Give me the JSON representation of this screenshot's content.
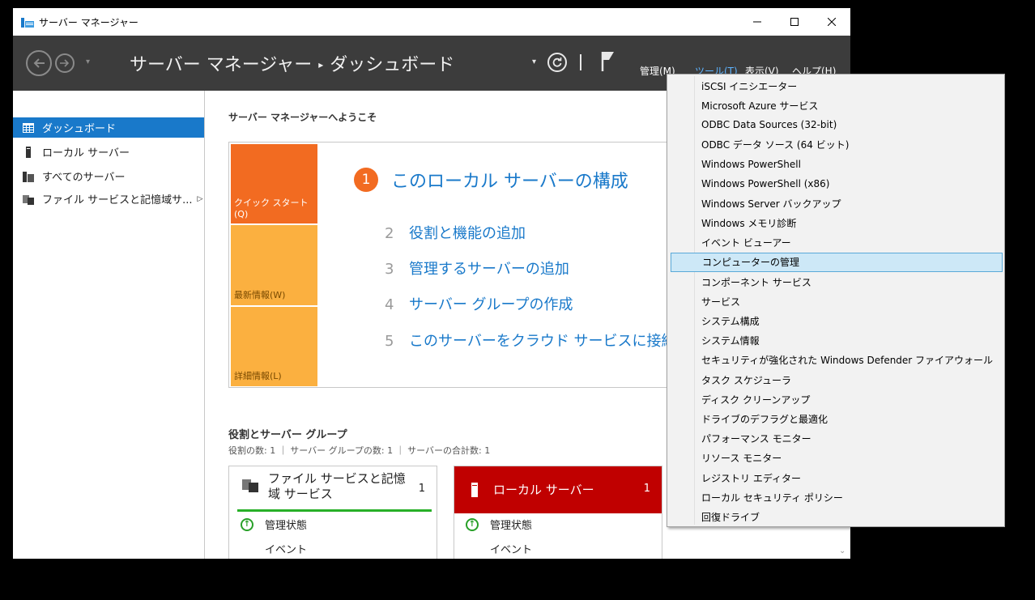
{
  "window": {
    "title": "サーバー マネージャー"
  },
  "header": {
    "breadcrumb_root": "サーバー マネージャー",
    "breadcrumb_sep": "▸",
    "breadcrumb_page": "ダッシュボード",
    "menus": [
      "管理(M)",
      "ツール(T)",
      "表示(V)",
      "ヘルプ(H)"
    ]
  },
  "sidebar": {
    "items": [
      {
        "label": "ダッシュボード",
        "icon": "dashboard-icon"
      },
      {
        "label": "ローカル サーバー",
        "icon": "server-icon"
      },
      {
        "label": "すべてのサーバー",
        "icon": "servers-icon"
      },
      {
        "label": "ファイル サービスと記憶域サ...",
        "icon": "file-services-icon"
      }
    ]
  },
  "main": {
    "welcome": "サーバー マネージャーへようこそ",
    "tiles": [
      "クイック スタート(Q)",
      "最新情報(W)",
      "詳細情報(L)"
    ],
    "step1": {
      "num": "1",
      "text": "このローカル サーバーの構成"
    },
    "steps": [
      {
        "num": "2",
        "text": "役割と機能の追加"
      },
      {
        "num": "3",
        "text": "管理するサーバーの追加"
      },
      {
        "num": "4",
        "text": "サーバー グループの作成"
      },
      {
        "num": "5",
        "text": "このサーバーをクラウド サービスに接続す"
      }
    ],
    "roles_title": "役割とサーバー グループ",
    "roles_sub": "役割の数: 1 ｜ サーバー グループの数: 1 ｜ サーバーの合計数: 1",
    "cards": [
      {
        "title": "ファイル サービスと記憶域 サービス",
        "count": "1",
        "rows": [
          "管理状態",
          "イベント"
        ]
      },
      {
        "title": "ローカル サーバー",
        "count": "1",
        "rows": [
          "管理状態",
          "イベント"
        ]
      }
    ]
  },
  "tools_menu": {
    "items": [
      "iSCSI イニシエーター",
      "Microsoft Azure サービス",
      "ODBC Data Sources (32-bit)",
      "ODBC データ ソース (64 ビット)",
      "Windows PowerShell",
      "Windows PowerShell (x86)",
      "Windows Server バックアップ",
      "Windows メモリ診断",
      "イベント ビューアー",
      "コンピューターの管理",
      "コンポーネント サービス",
      "サービス",
      "システム構成",
      "システム情報",
      "セキュリティが強化された Windows Defender ファイアウォール",
      "タスク スケジューラ",
      "ディスク クリーンアップ",
      "ドライブのデフラグと最適化",
      "パフォーマンス モニター",
      "リソース モニター",
      "レジストリ エディター",
      "ローカル セキュリティ ポリシー",
      "回復ドライブ"
    ],
    "highlighted_index": 9
  },
  "colors": {
    "accent": "#1979ca",
    "orange": "#f26b21",
    "amber": "#fbb040",
    "red": "#c00000",
    "green": "#28b028"
  }
}
